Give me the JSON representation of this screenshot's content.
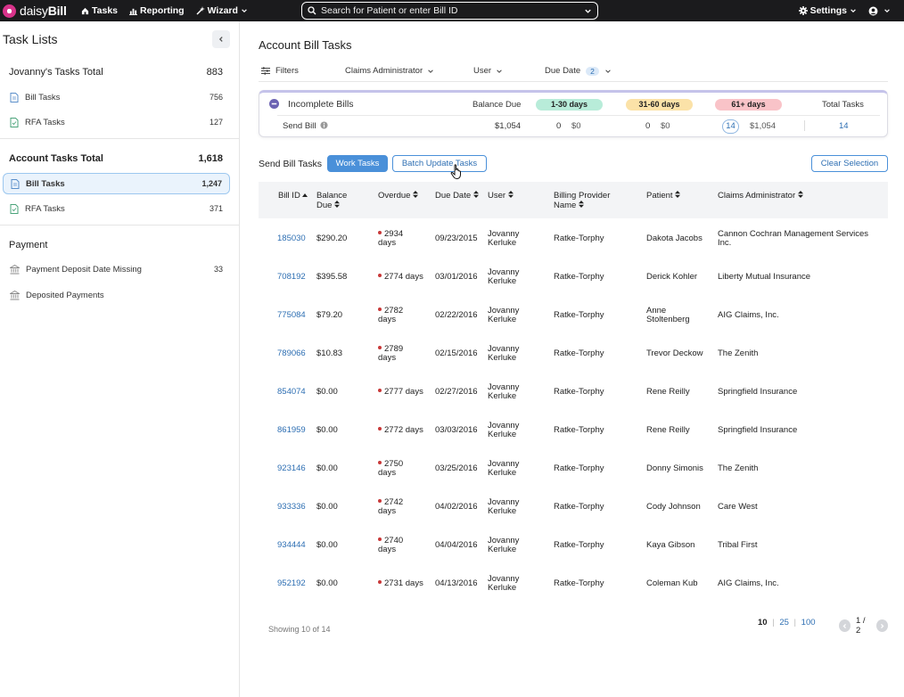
{
  "topbar": {
    "logo_text_light": "daisy",
    "logo_text_bold": "Bill",
    "nav": [
      {
        "label": "Tasks",
        "icon": "home-icon"
      },
      {
        "label": "Reporting",
        "icon": "bar-chart-icon"
      },
      {
        "label": "Wizard",
        "icon": "wand-icon"
      }
    ],
    "search_placeholder": "Search for Patient or enter Bill ID",
    "settings_label": "Settings"
  },
  "sidebar": {
    "title": "Task Lists",
    "sections": [
      {
        "heading": "Jovanny's Tasks Total",
        "count": "883",
        "items": [
          {
            "label": "Bill Tasks",
            "count": "756"
          },
          {
            "label": "RFA Tasks",
            "count": "127"
          }
        ]
      },
      {
        "heading": "Account Tasks Total",
        "count": "1,618",
        "items": [
          {
            "label": "Bill Tasks",
            "count": "1,247",
            "active": true
          },
          {
            "label": "RFA Tasks",
            "count": "371"
          }
        ]
      },
      {
        "heading": "Payment",
        "count": "",
        "items": [
          {
            "label": "Payment Deposit Date Missing",
            "count": "33"
          },
          {
            "label": "Deposited Payments",
            "count": ""
          }
        ]
      }
    ]
  },
  "main": {
    "title": "Account Bill Tasks",
    "filters": {
      "label": "Filters",
      "claims_admin": "Claims Administrator",
      "user": "User",
      "due_date": "Due Date",
      "due_date_count": "2"
    },
    "summary": {
      "title": "Incomplete Bills",
      "balance_due_label": "Balance Due",
      "badge_1_30": "1-30 days",
      "badge_31_60": "31-60 days",
      "badge_61": "61+ days",
      "total_label": "Total Tasks",
      "row": {
        "label": "Send Bill",
        "balance": "$1,054",
        "c1": "0",
        "a1": "$0",
        "c2": "0",
        "a2": "$0",
        "c3": "14",
        "a3": "$1,054",
        "total": "14"
      },
      "colors": {
        "b1": "#b8ecd9",
        "b2": "#fbe2a8",
        "b3": "#f9c3c8"
      }
    },
    "section_title": "Send Bill Tasks",
    "work_tasks_label": "Work Tasks",
    "batch_update_label": "Batch Update Tasks",
    "clear_selection_label": "Clear Selection",
    "columns": {
      "bill_id": "Bill ID",
      "balance_1": "Balance",
      "balance_2": "Due",
      "overdue": "Overdue",
      "due_date": "Due Date",
      "user": "User",
      "bp_1": "Billing Provider",
      "bp_2": "Name",
      "patient": "Patient",
      "claims_admin": "Claims Administrator"
    },
    "rows": [
      {
        "id": "185030",
        "balance": "$290.20",
        "od1": "2934",
        "od2": "days",
        "due": "09/23/2015",
        "u1": "Jovanny",
        "u2": "Kerluke",
        "provider": "Ratke-Torphy",
        "p1": "Dakota Jacobs",
        "p2": "",
        "ca1": "Cannon Cochran Management Services",
        "ca2": "Inc."
      },
      {
        "id": "708192",
        "balance": "$395.58",
        "od1": "2774 days",
        "od2": "",
        "due": "03/01/2016",
        "u1": "Jovanny",
        "u2": "Kerluke",
        "provider": "Ratke-Torphy",
        "p1": "Derick Kohler",
        "p2": "",
        "ca1": "Liberty Mutual Insurance",
        "ca2": ""
      },
      {
        "id": "775084",
        "balance": "$79.20",
        "od1": "2782",
        "od2": "days",
        "due": "02/22/2016",
        "u1": "Jovanny",
        "u2": "Kerluke",
        "provider": "Ratke-Torphy",
        "p1": "Anne",
        "p2": "Stoltenberg",
        "ca1": "AIG Claims, Inc.",
        "ca2": ""
      },
      {
        "id": "789066",
        "balance": "$10.83",
        "od1": "2789",
        "od2": "days",
        "due": "02/15/2016",
        "u1": "Jovanny",
        "u2": "Kerluke",
        "provider": "Ratke-Torphy",
        "p1": "Trevor Deckow",
        "p2": "",
        "ca1": "The Zenith",
        "ca2": ""
      },
      {
        "id": "854074",
        "balance": "$0.00",
        "od1": "2777 days",
        "od2": "",
        "due": "02/27/2016",
        "u1": "Jovanny",
        "u2": "Kerluke",
        "provider": "Ratke-Torphy",
        "p1": "Rene Reilly",
        "p2": "",
        "ca1": "Springfield Insurance",
        "ca2": ""
      },
      {
        "id": "861959",
        "balance": "$0.00",
        "od1": "2772 days",
        "od2": "",
        "due": "03/03/2016",
        "u1": "Jovanny",
        "u2": "Kerluke",
        "provider": "Ratke-Torphy",
        "p1": "Rene Reilly",
        "p2": "",
        "ca1": "Springfield Insurance",
        "ca2": ""
      },
      {
        "id": "923146",
        "balance": "$0.00",
        "od1": "2750",
        "od2": "days",
        "due": "03/25/2016",
        "u1": "Jovanny",
        "u2": "Kerluke",
        "provider": "Ratke-Torphy",
        "p1": "Donny Simonis",
        "p2": "",
        "ca1": "The Zenith",
        "ca2": ""
      },
      {
        "id": "933336",
        "balance": "$0.00",
        "od1": "2742",
        "od2": "days",
        "due": "04/02/2016",
        "u1": "Jovanny",
        "u2": "Kerluke",
        "provider": "Ratke-Torphy",
        "p1": "Cody Johnson",
        "p2": "",
        "ca1": "Care West",
        "ca2": ""
      },
      {
        "id": "934444",
        "balance": "$0.00",
        "od1": "2740",
        "od2": "days",
        "due": "04/04/2016",
        "u1": "Jovanny",
        "u2": "Kerluke",
        "provider": "Ratke-Torphy",
        "p1": "Kaya Gibson",
        "p2": "",
        "ca1": "Tribal First",
        "ca2": ""
      },
      {
        "id": "952192",
        "balance": "$0.00",
        "od1": "2731 days",
        "od2": "",
        "due": "04/13/2016",
        "u1": "Jovanny",
        "u2": "Kerluke",
        "provider": "Ratke-Torphy",
        "p1": "Coleman Kub",
        "p2": "",
        "ca1": "AIG Claims, Inc.",
        "ca2": ""
      }
    ],
    "showing": "Showing 10 of 14",
    "page_sizes": [
      "10",
      "25",
      "100"
    ],
    "page_sizes_sep": "|",
    "page_indicator": "1 / 2"
  }
}
